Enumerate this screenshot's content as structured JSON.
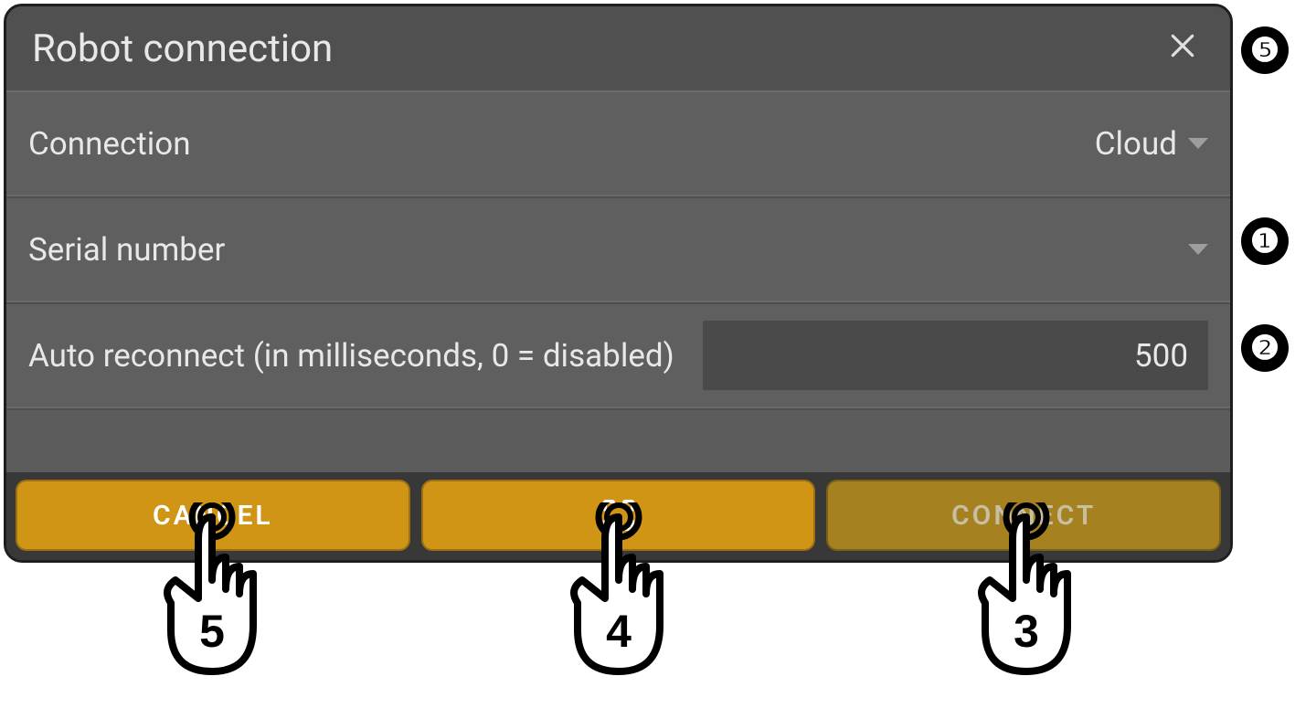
{
  "dialog": {
    "title": "Robot connection",
    "rows": {
      "connection": {
        "label": "Connection",
        "value": "Cloud"
      },
      "serial": {
        "label": "Serial number",
        "value": ""
      },
      "reconnect": {
        "label": "Auto reconnect (in milliseconds, 0 = disabled)",
        "value": "500"
      }
    },
    "buttons": {
      "cancel": "CANCEL",
      "connect": "CONNECT"
    }
  },
  "callouts": {
    "c5_top": "❺",
    "c1": "❶",
    "c2": "❷"
  },
  "hands": {
    "h5": "5",
    "h4": "4",
    "h3": "3"
  }
}
